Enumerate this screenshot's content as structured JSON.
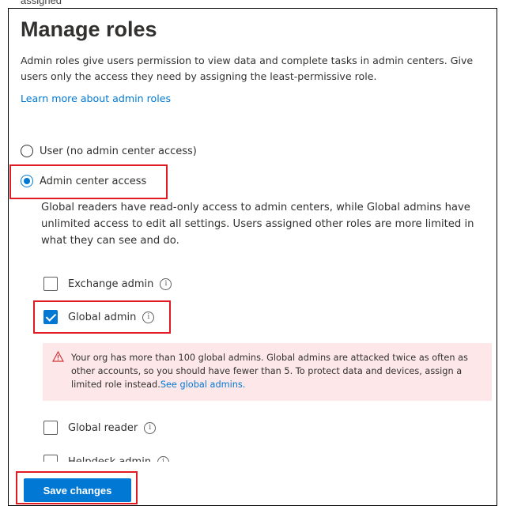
{
  "header": {
    "cut_text": "assigned",
    "title": "Manage roles",
    "description": "Admin roles give users permission to view data and complete tasks in admin centers. Give users only the access they need by assigning the least-permissive role.",
    "learn_link": "Learn more about admin roles"
  },
  "access_options": [
    {
      "label": "User (no admin center access)",
      "selected": false
    },
    {
      "label": "Admin center access",
      "selected": true
    }
  ],
  "admin_access_info": "Global readers have read-only access to admin centers, while Global admins have unlimited access to edit all settings. Users assigned other roles are more limited in what they can see and do.",
  "roles": [
    {
      "label": "Exchange admin",
      "checked": false
    },
    {
      "label": "Global admin",
      "checked": true
    },
    {
      "label": "Global reader",
      "checked": false
    },
    {
      "label": "Helpdesk admin",
      "checked": false
    }
  ],
  "warning": {
    "text": "Your org has more than 100 global admins. Global admins are attacked twice as often as other accounts, so you should have fewer than 5. To protect data and devices, assign a limited role instead.",
    "link": "See global admins."
  },
  "footer": {
    "save_label": "Save changes"
  },
  "colors": {
    "accent": "#0078d4",
    "highlight_box": "#e01b24",
    "warning_bg": "#fde7e9",
    "warning_icon": "#d13438"
  }
}
